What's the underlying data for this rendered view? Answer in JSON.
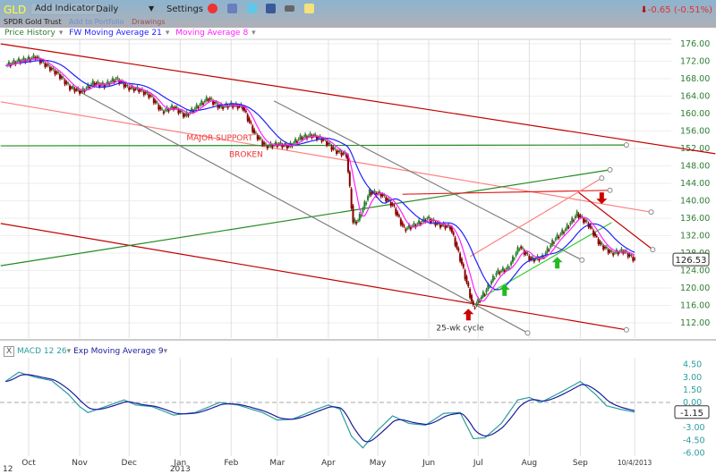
{
  "toolbar": {
    "ticker": "GLD",
    "add_indicator": "Add Indicator",
    "period": "Daily",
    "settings": "Settings",
    "name": "SPDR Gold Trust",
    "add_portfolio": "Add to Portfolio",
    "drawings": "Drawings",
    "change": "-0.65 (-0.51%)",
    "change_color": "#e03030",
    "icons": [
      "alarm-clock-icon",
      "book-icon",
      "twitter-icon",
      "facebook-icon",
      "camera-icon",
      "note-icon"
    ]
  },
  "legend": {
    "price": "Price History",
    "ma21": "FW Moving Average 21",
    "ma8": "Moving Average 8",
    "macd": "MACD 12 26",
    "ema9": "Exp Moving Average 9",
    "close_box": "X"
  },
  "chart_data": [
    {
      "type": "candlestick",
      "ylim": [
        110,
        178
      ],
      "yticks": [
        "176.00",
        "172.00",
        "168.00",
        "164.00",
        "160.00",
        "156.00",
        "152.00",
        "148.00",
        "144.00",
        "140.00",
        "136.00",
        "132.00",
        "128.00",
        "124.00",
        "120.00",
        "116.00",
        "112.00"
      ],
      "last_price": "126.53",
      "xticks": [
        [
          "2012-10-01",
          "Oct"
        ],
        [
          "2012-11-01",
          "Nov"
        ],
        [
          "2012-12-01",
          "Dec"
        ],
        [
          "2013-01-01",
          "Jan"
        ],
        [
          "2013-02-01",
          "Feb"
        ],
        [
          "2013-03-01",
          "Mar"
        ],
        [
          "2013-04-01",
          "Apr"
        ],
        [
          "2013-05-01",
          "May"
        ],
        [
          "2013-06-01",
          "Jun"
        ],
        [
          "2013-07-01",
          "Jul"
        ],
        [
          "2013-08-01",
          "Aug"
        ],
        [
          "2013-09-01",
          "Sep"
        ],
        [
          "2013-10-04",
          "10/4/2013"
        ]
      ],
      "xsub": {
        "year_left": "12",
        "year_jan": "2013"
      },
      "series": {
        "colors": {
          "up": "#2e7d32",
          "down": "#8b0000",
          "ma21": "#2020ff",
          "ma8": "#ff20ff"
        },
        "close": [
          [
            "2012-09-17",
            171
          ],
          [
            "2012-09-24",
            172
          ],
          [
            "2012-10-01",
            172.5
          ],
          [
            "2012-10-05",
            173
          ],
          [
            "2012-10-12",
            171
          ],
          [
            "2012-10-19",
            169
          ],
          [
            "2012-10-26",
            166
          ],
          [
            "2012-11-02",
            165
          ],
          [
            "2012-11-09",
            167
          ],
          [
            "2012-11-16",
            166.5
          ],
          [
            "2012-11-23",
            168
          ],
          [
            "2012-11-30",
            166
          ],
          [
            "2012-12-07",
            165.5
          ],
          [
            "2012-12-14",
            164
          ],
          [
            "2012-12-21",
            160.5
          ],
          [
            "2012-12-28",
            161.5
          ],
          [
            "2013-01-04",
            159.5
          ],
          [
            "2013-01-11",
            161.5
          ],
          [
            "2013-01-18",
            163.5
          ],
          [
            "2013-01-25",
            161.5
          ],
          [
            "2013-02-01",
            162
          ],
          [
            "2013-02-08",
            161.5
          ],
          [
            "2013-02-15",
            155.5
          ],
          [
            "2013-02-22",
            152.5
          ],
          [
            "2013-03-01",
            153
          ],
          [
            "2013-03-08",
            152.5
          ],
          [
            "2013-03-15",
            154.5
          ],
          [
            "2013-03-22",
            155
          ],
          [
            "2013-03-29",
            154
          ],
          [
            "2013-04-05",
            151.5
          ],
          [
            "2013-04-12",
            150.5
          ],
          [
            "2013-04-16",
            135
          ],
          [
            "2013-04-19",
            135.5
          ],
          [
            "2013-04-26",
            142
          ],
          [
            "2013-05-03",
            141.5
          ],
          [
            "2013-05-10",
            139
          ],
          [
            "2013-05-17",
            133.5
          ],
          [
            "2013-05-24",
            134.5
          ],
          [
            "2013-05-31",
            136
          ],
          [
            "2013-06-07",
            134.5
          ],
          [
            "2013-06-14",
            134
          ],
          [
            "2013-06-21",
            125.5
          ],
          [
            "2013-06-28",
            115.5
          ],
          [
            "2013-07-05",
            119
          ],
          [
            "2013-07-12",
            123.5
          ],
          [
            "2013-07-19",
            124.5
          ],
          [
            "2013-07-26",
            129.5
          ],
          [
            "2013-08-02",
            126.5
          ],
          [
            "2013-08-09",
            127
          ],
          [
            "2013-08-16",
            131
          ],
          [
            "2013-08-23",
            133.5
          ],
          [
            "2013-08-30",
            137
          ],
          [
            "2013-09-06",
            134.5
          ],
          [
            "2013-09-13",
            130
          ],
          [
            "2013-09-20",
            128
          ],
          [
            "2013-09-27",
            128.5
          ],
          [
            "2013-10-04",
            126.53
          ]
        ]
      },
      "trendlines": [
        {
          "color": "#c00000",
          "from": [
            "2012-09-14",
            176
          ],
          "to": [
            "2013-11-22",
            150.8
          ],
          "handle": false
        },
        {
          "color": "#c00000",
          "from": [
            "2012-09-14",
            134.8
          ],
          "to": [
            "2013-09-29",
            110.4
          ],
          "handle": true
        },
        {
          "color": "#ff8080",
          "from": [
            "2012-09-14",
            162.7
          ],
          "to": [
            "2013-10-14",
            137.4
          ],
          "handle": true
        },
        {
          "color": "#228b22",
          "from": [
            "2012-09-14",
            152.6
          ],
          "to": [
            "2013-09-29",
            152.8
          ],
          "handle": true
        },
        {
          "color": "#228b22",
          "from": [
            "2012-09-14",
            125.1
          ],
          "to": [
            "2013-09-19",
            147.1
          ],
          "handle": true
        },
        {
          "color": "#808080",
          "from": [
            "2012-10-26",
            166.2
          ],
          "to": [
            "2013-07-31",
            109.7
          ],
          "handle": true
        },
        {
          "color": "#808080",
          "from": [
            "2013-02-27",
            162.9
          ],
          "to": [
            "2013-09-02",
            126.4
          ],
          "handle": true
        },
        {
          "color": "#e02020",
          "from": [
            "2013-05-16",
            141.5
          ],
          "to": [
            "2013-09-19",
            142.4
          ],
          "handle": true
        },
        {
          "color": "#ff8080",
          "from": [
            "2013-06-26",
            127.2
          ],
          "to": [
            "2013-09-14",
            145.2
          ],
          "handle": true
        },
        {
          "color": "#33cc33",
          "from": [
            "2013-06-30",
            117.1
          ],
          "to": [
            "2013-09-20",
            135.0
          ],
          "handle": false
        },
        {
          "color": "#c00000",
          "from": [
            "2013-08-31",
            141.9
          ],
          "to": [
            "2013-10-15",
            128.8
          ],
          "handle": true
        }
      ],
      "arrows": [
        {
          "dir": "down",
          "color": "#cc0000",
          "at": [
            "2013-09-14",
            140.7
          ]
        },
        {
          "dir": "up",
          "color": "#cc0000",
          "at": [
            "2013-06-25",
            113.8
          ]
        },
        {
          "dir": "up",
          "color": "#22bb22",
          "at": [
            "2013-07-17",
            119.4
          ]
        },
        {
          "dir": "up",
          "color": "#22bb22",
          "at": [
            "2013-08-18",
            125.7
          ]
        }
      ],
      "annotations": [
        {
          "text": "MAJOR SUPPORT",
          "color": "#ee3333",
          "at": [
            "2013-01-25",
            153.8
          ]
        },
        {
          "text": "BROKEN",
          "color": "#ee3333",
          "at": [
            "2013-02-10",
            150.1
          ]
        },
        {
          "text": "25-wk cycle",
          "color": "#333333",
          "at": [
            "2013-06-20",
            110.3
          ]
        }
      ]
    },
    {
      "type": "line",
      "ylim": [
        -6.5,
        5.2
      ],
      "yticks": [
        "4.50",
        "3.00",
        "1.50",
        "0.00",
        "-1.50",
        "-3.00",
        "-4.50",
        "-6.00"
      ],
      "last_value": "-1.15",
      "series": [
        {
          "name": "MACD 12 26",
          "color": "#2a9d9d",
          "values": [
            [
              "2012-09-17",
              2.5
            ],
            [
              "2012-09-25",
              3.6
            ],
            [
              "2012-10-05",
              3.0
            ],
            [
              "2012-10-15",
              2.6
            ],
            [
              "2012-10-25",
              1.0
            ],
            [
              "2012-11-01",
              -0.5
            ],
            [
              "2012-11-06",
              -1.2
            ],
            [
              "2012-11-15",
              -0.6
            ],
            [
              "2012-11-28",
              0.3
            ],
            [
              "2012-12-05",
              -0.3
            ],
            [
              "2012-12-15",
              -0.5
            ],
            [
              "2012-12-28",
              -1.5
            ],
            [
              "2013-01-10",
              -1.2
            ],
            [
              "2013-01-25",
              0.0
            ],
            [
              "2013-02-05",
              -0.3
            ],
            [
              "2013-02-20",
              -1.2
            ],
            [
              "2013-03-01",
              -2.1
            ],
            [
              "2013-03-10",
              -2.0
            ],
            [
              "2013-03-25",
              -0.8
            ],
            [
              "2013-04-01",
              -0.3
            ],
            [
              "2013-04-08",
              -0.8
            ],
            [
              "2013-04-15",
              -4.0
            ],
            [
              "2013-04-22",
              -5.4
            ],
            [
              "2013-04-30",
              -3.5
            ],
            [
              "2013-05-10",
              -1.6
            ],
            [
              "2013-05-20",
              -2.5
            ],
            [
              "2013-05-30",
              -2.7
            ],
            [
              "2013-06-10",
              -1.3
            ],
            [
              "2013-06-20",
              -1.2
            ],
            [
              "2013-06-28",
              -4.3
            ],
            [
              "2013-07-05",
              -4.2
            ],
            [
              "2013-07-15",
              -2.5
            ],
            [
              "2013-07-25",
              0.3
            ],
            [
              "2013-08-01",
              0.6
            ],
            [
              "2013-08-08",
              0.0
            ],
            [
              "2013-08-20",
              1.2
            ],
            [
              "2013-09-01",
              2.5
            ],
            [
              "2013-09-10",
              1.0
            ],
            [
              "2013-09-17",
              -0.4
            ],
            [
              "2013-09-25",
              -0.8
            ],
            [
              "2013-10-04",
              -1.15
            ]
          ]
        },
        {
          "name": "Exp Moving Average 9",
          "color": "#1a1a9c",
          "derived_from": "MACD 12 26"
        }
      ]
    }
  ]
}
